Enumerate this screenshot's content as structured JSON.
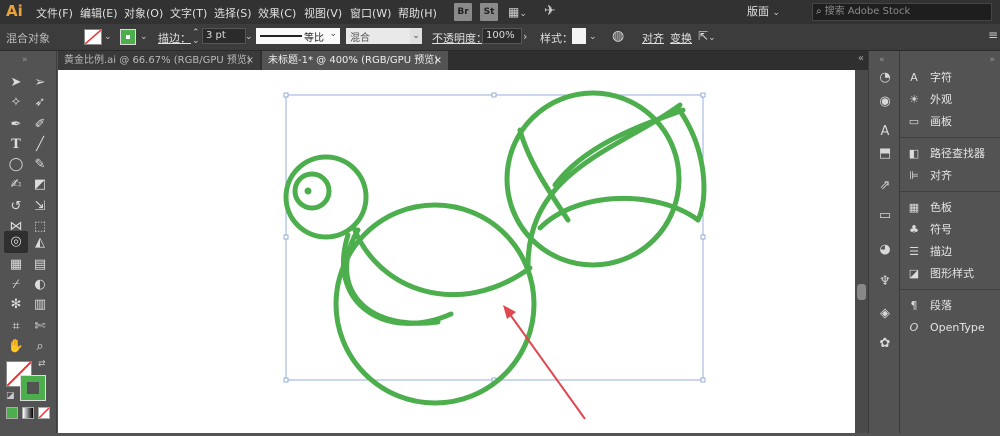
{
  "app": {
    "logo": "Ai"
  },
  "menu": [
    "文件(F)",
    "编辑(E)",
    "对象(O)",
    "文字(T)",
    "选择(S)",
    "效果(C)",
    "视图(V)",
    "窗口(W)",
    "帮助(H)"
  ],
  "bridge_label": "Br",
  "stock_label": "St",
  "workspace": "版面",
  "search_placeholder": "搜索 Adobe Stock",
  "control": {
    "selection_label": "混合对象",
    "stroke_label": "描边：",
    "stroke_weight": "3 pt",
    "profile_label": "等比",
    "blend_mode": "混合",
    "opacity_label": "不透明度：",
    "opacity_value": "100%",
    "style_label": "样式：",
    "align_label": "对齐",
    "transform_label": "变换"
  },
  "tabs": [
    {
      "title": "黄金比例.ai @ 66.67% (RGB/GPU 预览)",
      "close": "×",
      "active": false
    },
    {
      "title": "未标题-1* @ 400% (RGB/GPU 预览)",
      "close": "×",
      "active": true
    }
  ],
  "panels": [
    {
      "icon": "character-icon",
      "glyph": "A",
      "label": "字符"
    },
    {
      "icon": "appearance-icon",
      "glyph": "☀",
      "label": "外观"
    },
    {
      "icon": "artboard-icon",
      "glyph": "▭",
      "label": "画板"
    },
    {
      "icon": "pathfinder-icon",
      "glyph": "◧",
      "label": "路径查找器"
    },
    {
      "icon": "align-icon",
      "glyph": "⊫",
      "label": "对齐"
    },
    {
      "icon": "swatches-icon",
      "glyph": "▦",
      "label": "色板"
    },
    {
      "icon": "symbols-icon",
      "glyph": "♣",
      "label": "符号"
    },
    {
      "icon": "stroke-icon",
      "glyph": "☰",
      "label": "描边"
    },
    {
      "icon": "graphic-styles-icon",
      "glyph": "◪",
      "label": "图形样式"
    },
    {
      "icon": "paragraph-icon",
      "glyph": "¶",
      "label": "段落"
    },
    {
      "icon": "opentype-icon",
      "glyph": "O",
      "label": "OpenType"
    }
  ],
  "colors": {
    "shape_stroke": "#4cae4c",
    "arrow": "#e0484e",
    "bbox": "#7b9bd1",
    "fill_swatch": "#4cae4c"
  }
}
